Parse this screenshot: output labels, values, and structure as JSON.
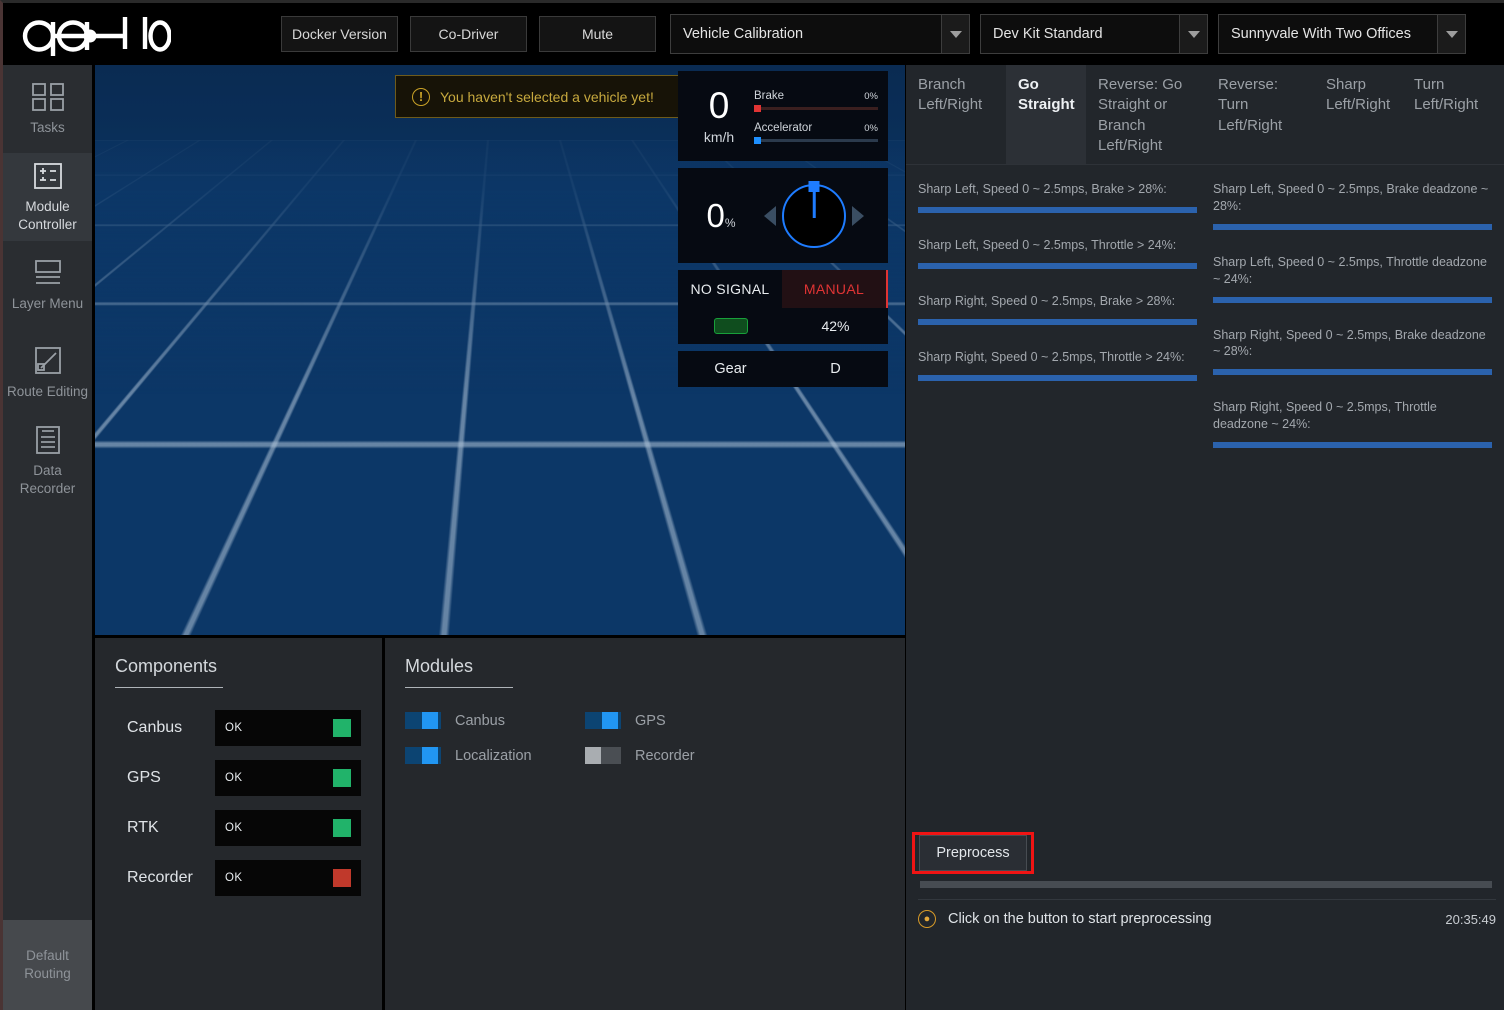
{
  "header": {
    "logo_text": "apollo",
    "buttons": [
      {
        "label": "Docker Version",
        "name": "docker-version-button"
      },
      {
        "label": "Co-Driver",
        "name": "co-driver-button"
      },
      {
        "label": "Mute",
        "name": "mute-button"
      }
    ],
    "selects": [
      {
        "name": "mode-select",
        "value": "Vehicle Calibration"
      },
      {
        "name": "vehicle-select",
        "value": "Dev Kit Standard"
      },
      {
        "name": "map-select",
        "value": "Sunnyvale With Two Offices"
      }
    ]
  },
  "sidebar": {
    "items": [
      {
        "label": "Tasks",
        "icon": "grid-icon",
        "active": false
      },
      {
        "label": "Module Controller",
        "icon": "module-controller-icon",
        "active": true
      },
      {
        "label": "Layer Menu",
        "icon": "layers-icon",
        "active": false
      },
      {
        "label": "Route Editing",
        "icon": "route-editing-icon",
        "active": false
      },
      {
        "label": "Data Recorder",
        "icon": "data-recorder-icon",
        "active": false
      }
    ],
    "bottom": {
      "label": "Default Routing",
      "name": "default-routing-button"
    }
  },
  "viewport": {
    "warning": {
      "icon": "warning-icon",
      "text": "You haven't selected a vehicle yet!"
    },
    "vehicle_marker": "ego-vehicle-icon"
  },
  "hud": {
    "speed_value": "0",
    "speed_unit": "km/h",
    "brake_label": "Brake",
    "brake_value": "0%",
    "accelerator_label": "Accelerator",
    "accelerator_value": "0%",
    "steer_value": "0",
    "steer_unit": "%",
    "signal_status": "NO SIGNAL",
    "drive_mode": "MANUAL",
    "battery_pct": "42%",
    "gear_label": "Gear",
    "gear_value": "D"
  },
  "components": {
    "title": "Components",
    "rows": [
      {
        "name": "Canbus",
        "status": "OK",
        "color": "#21b36a"
      },
      {
        "name": "GPS",
        "status": "OK",
        "color": "#21b36a"
      },
      {
        "name": "RTK",
        "status": "OK",
        "color": "#21b36a"
      },
      {
        "name": "Recorder",
        "status": "OK",
        "color": "#c0392b"
      }
    ]
  },
  "modules": {
    "title": "Modules",
    "items": [
      {
        "name": "Canbus",
        "on": true
      },
      {
        "name": "GPS",
        "on": true
      },
      {
        "name": "Localization",
        "on": true
      },
      {
        "name": "Recorder",
        "on": false
      }
    ]
  },
  "right_panel": {
    "tabs": [
      {
        "label": "Branch Left/Right",
        "active": false
      },
      {
        "label": "Go Straight",
        "active": true
      },
      {
        "label": "Reverse: Go Straight or Branch Left/Right",
        "active": false
      },
      {
        "label": "Reverse: Turn Left/Right",
        "active": false
      },
      {
        "label": "Sharp Left/Right",
        "active": false
      },
      {
        "label": "Turn Left/Right",
        "active": false
      }
    ],
    "progress_left": [
      {
        "label": "Sharp Left, Speed 0 ~ 2.5mps, Brake > 28%:",
        "pct": 100
      },
      {
        "label": "Sharp Left, Speed 0 ~ 2.5mps, Throttle > 24%:",
        "pct": 100
      },
      {
        "label": "Sharp Right, Speed 0 ~ 2.5mps, Brake > 28%:",
        "pct": 100
      },
      {
        "label": "Sharp Right, Speed 0 ~ 2.5mps, Throttle > 24%:",
        "pct": 100
      }
    ],
    "progress_right": [
      {
        "label": "Sharp Left, Speed 0 ~ 2.5mps, Brake deadzone ~ 28%:",
        "pct": 100
      },
      {
        "label": "Sharp Left, Speed 0 ~ 2.5mps, Throttle deadzone ~ 24%:",
        "pct": 100
      },
      {
        "label": "Sharp Right, Speed 0 ~ 2.5mps, Brake deadzone ~ 28%:",
        "pct": 100
      },
      {
        "label": "Sharp Right, Speed 0 ~ 2.5mps, Throttle deadzone ~ 24%:",
        "pct": 100
      }
    ],
    "preprocess_label": "Preprocess",
    "console": {
      "icon": "bell-icon",
      "message": "Click on the button to start preprocessing",
      "time": "20:35:49"
    }
  },
  "colors": {
    "accent_blue": "#2b62ad",
    "highlight_red": "#f01414",
    "warning_yellow": "#c7a93e",
    "ok_green": "#21b36a",
    "error_red": "#c0392b"
  }
}
